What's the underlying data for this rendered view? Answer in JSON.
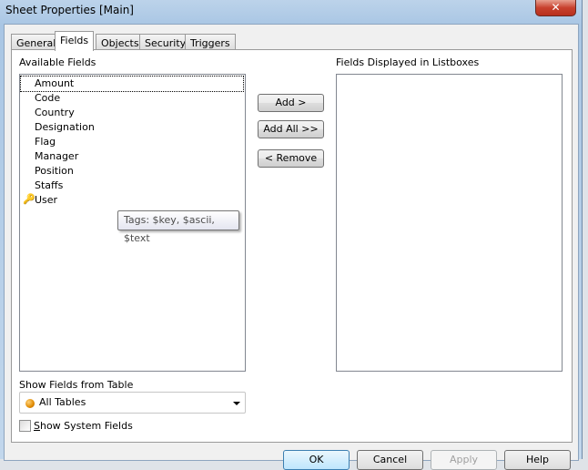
{
  "window": {
    "title": "Sheet Properties [Main]",
    "close_glyph": "✕"
  },
  "tabs": [
    {
      "label": "General"
    },
    {
      "label": "Fields"
    },
    {
      "label": "Objects"
    },
    {
      "label": "Security"
    },
    {
      "label": "Triggers"
    }
  ],
  "available": {
    "label": "Available Fields",
    "items": [
      "Amount",
      "Code",
      "Country",
      "Designation",
      "Flag",
      "Manager",
      "Position",
      "Staffs",
      "User"
    ],
    "key_icon_item": "User"
  },
  "displayed": {
    "label": "Fields Displayed in Listboxes"
  },
  "buttons": {
    "add": "Add >",
    "add_all": "Add All >>",
    "remove": "< Remove"
  },
  "tooltip": "Tags: $key, $ascii, $text",
  "table": {
    "label": "Show Fields from Table",
    "value": "All Tables"
  },
  "system_fields": {
    "label_first": "S",
    "label_rest": "how System Fields",
    "checked": false
  },
  "footer": {
    "ok": "OK",
    "cancel": "Cancel",
    "apply": "Apply",
    "help": "Help"
  }
}
